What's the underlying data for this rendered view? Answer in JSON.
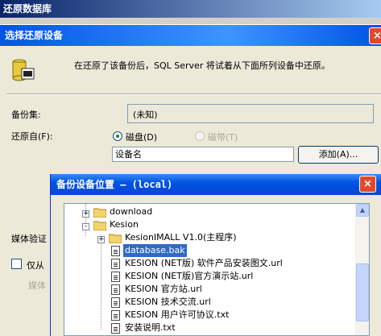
{
  "back_window": {
    "title": "还原数据库"
  },
  "restore_dialog": {
    "title": "选择还原设备",
    "close_label": "×",
    "info": "在还原了该备份后，SQL Server 将试着从下面所列设备中还原。",
    "backup_set_label": "备份集:",
    "backup_set_value": "(未知)",
    "restore_from_label": "还原自(F):",
    "disk_label": "磁盘(D)",
    "tape_label": "磁带(T)",
    "device_column": "设备名",
    "add_button": "添加(A)...",
    "media_verify_label": "媒体验证",
    "only_from_label": "仅从",
    "media_label": "媒体"
  },
  "device_dialog": {
    "title": "备份设备位置 — (local)",
    "close_label": "×",
    "tree": [
      {
        "label": "download",
        "kind": "folder",
        "expander": "+"
      },
      {
        "label": "Kesion",
        "kind": "folder",
        "expander": "-"
      },
      {
        "label": "KesionIMALL V1.0(主程序)",
        "kind": "folder",
        "expander": "+"
      },
      {
        "label": "database.bak",
        "kind": "file",
        "selected": true
      },
      {
        "label": "KESION (NET版) 软件产品安装图文.url",
        "kind": "file"
      },
      {
        "label": "KESION (NET版)官方演示站.url",
        "kind": "file"
      },
      {
        "label": "KESION 官方站.url",
        "kind": "file"
      },
      {
        "label": "KESION 技术交流.url",
        "kind": "file"
      },
      {
        "label": "KESION 用户许可协议.txt",
        "kind": "file"
      },
      {
        "label": "安装说明.txt",
        "kind": "file"
      }
    ]
  },
  "icons": [
    "database-icon",
    "folder-icon",
    "file-icon",
    "close-icon",
    "scroll-up-icon",
    "scroll-down-icon"
  ],
  "colors": {
    "title_blue": "#0054e3",
    "selection": "#316ac5",
    "close_red": "#e04a2a"
  }
}
